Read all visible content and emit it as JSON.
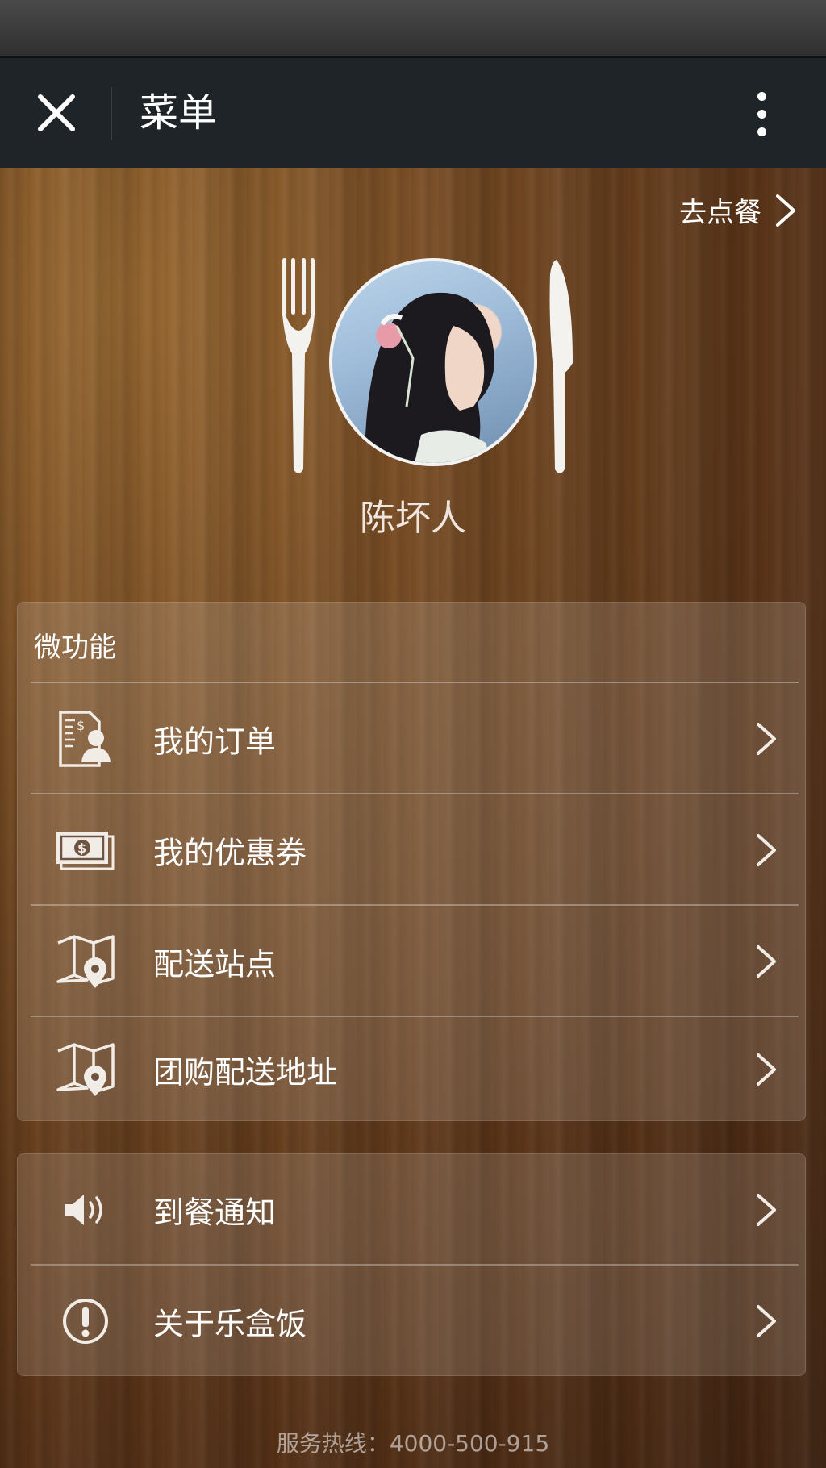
{
  "header": {
    "title": "菜单",
    "close_icon": "close-icon",
    "more_icon": "more-vertical-icon"
  },
  "top_link": {
    "label": "去点餐",
    "icon": "chevron-right-icon"
  },
  "profile": {
    "user_name": "陈坏人",
    "avatar": "avatar-photo",
    "decor_icons": [
      "fork-icon",
      "knife-icon"
    ]
  },
  "sections": [
    {
      "title": "微功能",
      "items": [
        {
          "label": "我的订单",
          "icon": "order-document-icon"
        },
        {
          "label": "我的优惠券",
          "icon": "coupon-cash-icon"
        },
        {
          "label": "配送站点",
          "icon": "map-pin-icon"
        },
        {
          "label": "团购配送地址",
          "icon": "map-pin-icon"
        }
      ]
    },
    {
      "title": "",
      "items": [
        {
          "label": "到餐通知",
          "icon": "speaker-icon"
        },
        {
          "label": "关于乐盒饭",
          "icon": "info-exclamation-icon"
        }
      ]
    }
  ],
  "footer": {
    "hotline": "服务热线：4000-500-915"
  },
  "colors": {
    "title_bar": "#1f2428",
    "status_bar": "#3a3a3a",
    "wood_light": "#9a6a32",
    "wood_dark": "#3e2210",
    "text_primary": "#ffffff"
  }
}
